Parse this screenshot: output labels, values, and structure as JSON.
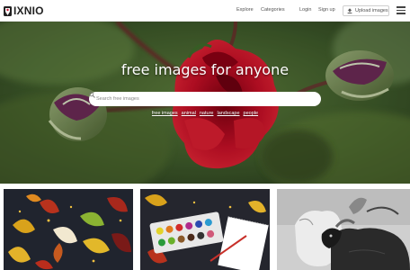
{
  "header": {
    "logo_text": "IXNIO",
    "nav": {
      "explore": "Explore",
      "categories": "Categories",
      "login": "Login",
      "signup": "Sign up",
      "upload": "Upload images"
    }
  },
  "hero": {
    "title": "free images for anyone",
    "search": {
      "placeholder": "Search free images"
    },
    "tags": [
      "free images",
      "animal",
      "nature",
      "landscape",
      "people"
    ]
  },
  "colors": {
    "brand": "#222222",
    "accent_red": "#c8102e"
  },
  "icons": [
    "logo-icon",
    "upload-icon",
    "hamburger-menu-icon",
    "search-icon"
  ]
}
